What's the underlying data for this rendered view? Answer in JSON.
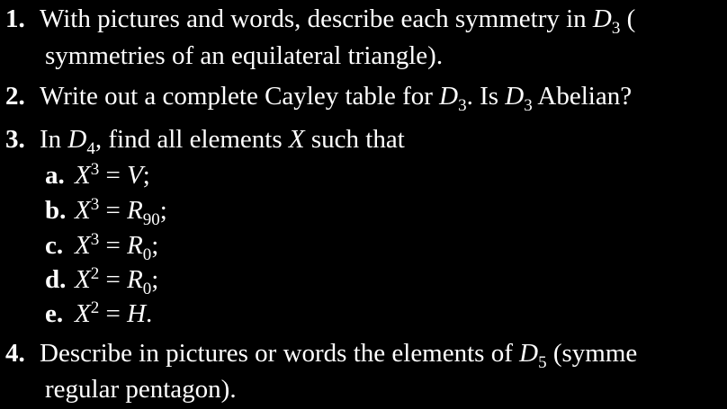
{
  "problems": [
    {
      "number": "1.",
      "text_a": "With pictures and words, describe each symmetry in ",
      "sym": "D",
      "sub": "3",
      "text_b": " (",
      "line2": "symmetries of an equilateral triangle)."
    },
    {
      "number": "2.",
      "text_a": "Write out a complete Cayley table for ",
      "sym1": "D",
      "sub1": "3",
      "text_b": ". Is ",
      "sym2": "D",
      "sub2": "3",
      "text_c": " Abelian?"
    },
    {
      "number": "3.",
      "text_a": "In ",
      "sym": "D",
      "sub": "4",
      "text_b": ", find all elements ",
      "var": "X",
      "text_c": " such that",
      "parts": [
        {
          "label": "a.",
          "var": "X",
          "exp": "3",
          "eq": " = ",
          "rhs": "V",
          "rhs_sub": "",
          "end": ";"
        },
        {
          "label": "b.",
          "var": "X",
          "exp": "3",
          "eq": " = ",
          "rhs": "R",
          "rhs_sub": "90",
          "end": ";"
        },
        {
          "label": "c.",
          "var": "X",
          "exp": "3",
          "eq": " = ",
          "rhs": "R",
          "rhs_sub": "0",
          "end": ";"
        },
        {
          "label": "d.",
          "var": "X",
          "exp": "2",
          "eq": " = ",
          "rhs": "R",
          "rhs_sub": "0",
          "end": ";"
        },
        {
          "label": "e.",
          "var": "X",
          "exp": "2",
          "eq": " = ",
          "rhs": "H",
          "rhs_sub": "",
          "end": "."
        }
      ]
    },
    {
      "number": "4.",
      "text_a": "Describe in pictures or words the elements of ",
      "sym": "D",
      "sub": "5",
      "text_b": " (symme",
      "line2": "regular pentagon)."
    }
  ]
}
